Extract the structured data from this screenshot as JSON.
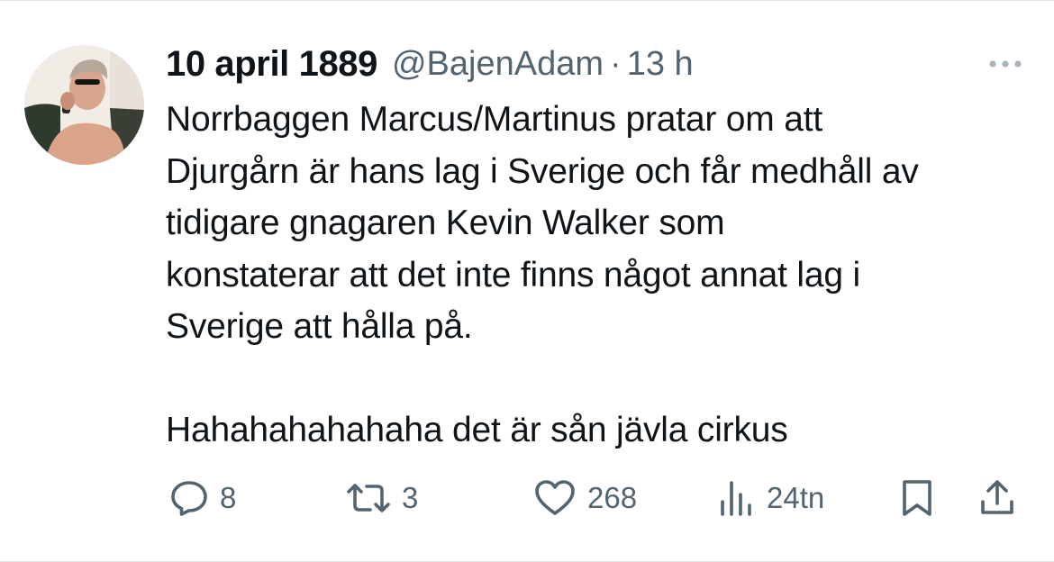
{
  "tweet": {
    "display_name": "10 april 1889",
    "handle": "@BajenAdam",
    "separator": "·",
    "time": "13 h",
    "text_lines": [
      "Norrbaggen Marcus/Martinus pratar om att",
      "Djurgårn är hans lag i Sverige och får medhåll av",
      "tidigare gnagaren Kevin Walker som",
      "konstaterar att det inte finns något annat lag i",
      "Sverige att hålla på."
    ],
    "text_last_line": "Hahahahahahaha det är sån jävla cirkus"
  },
  "actions": {
    "replies": {
      "icon": "reply-icon",
      "count": "8"
    },
    "retweets": {
      "icon": "retweet-icon",
      "count": "3"
    },
    "likes": {
      "icon": "heart-icon",
      "count": "268"
    },
    "views": {
      "icon": "views-icon",
      "count": "24tn"
    },
    "bookmark": {
      "icon": "bookmark-icon"
    },
    "share": {
      "icon": "share-icon"
    }
  },
  "colors": {
    "text": "#0f1419",
    "secondary": "#536471",
    "border": "#e3e6e9"
  }
}
